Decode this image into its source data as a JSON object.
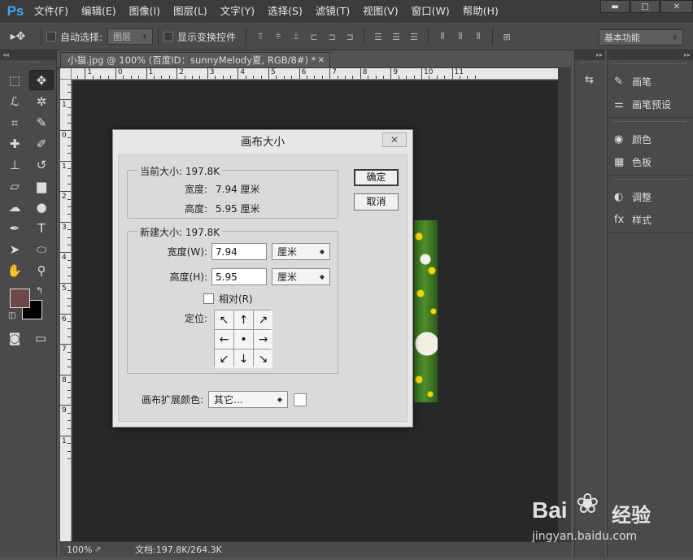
{
  "app": {
    "logo": "Ps"
  },
  "menu": [
    "文件(F)",
    "编辑(E)",
    "图像(I)",
    "图层(L)",
    "文字(Y)",
    "选择(S)",
    "滤镜(T)",
    "视图(V)",
    "窗口(W)",
    "帮助(H)"
  ],
  "window_controls": {
    "minimize": "▬",
    "maximize": "□",
    "close": "✕"
  },
  "options_bar": {
    "tool_glyph": "▸✥",
    "auto_select_label": "自动选择:",
    "auto_select_value": "图层",
    "show_transform_label": "显示变换控件",
    "workspace": "基本功能"
  },
  "toolbar": {
    "collapse": "◂◂",
    "tools": [
      {
        "name": "marquee-tool-icon",
        "glyph": "⬚"
      },
      {
        "name": "move-tool-icon",
        "glyph": "✥"
      },
      {
        "name": "lasso-tool-icon",
        "glyph": "ℒ"
      },
      {
        "name": "magic-wand-icon",
        "glyph": "✲"
      },
      {
        "name": "crop-tool-icon",
        "glyph": "⌗"
      },
      {
        "name": "eyedropper-icon",
        "glyph": "✎"
      },
      {
        "name": "healing-brush-icon",
        "glyph": "✚"
      },
      {
        "name": "brush-tool-icon",
        "glyph": "✐"
      },
      {
        "name": "clone-stamp-icon",
        "glyph": "⊥"
      },
      {
        "name": "history-brush-icon",
        "glyph": "↺"
      },
      {
        "name": "eraser-tool-icon",
        "glyph": "▱"
      },
      {
        "name": "gradient-tool-icon",
        "glyph": "▆"
      },
      {
        "name": "blur-tool-icon",
        "glyph": "☁"
      },
      {
        "name": "dodge-tool-icon",
        "glyph": "●"
      },
      {
        "name": "pen-tool-icon",
        "glyph": "✒"
      },
      {
        "name": "type-tool-icon",
        "glyph": "T"
      },
      {
        "name": "path-select-icon",
        "glyph": "➤"
      },
      {
        "name": "ellipse-tool-icon",
        "glyph": "⬭"
      },
      {
        "name": "hand-tool-icon",
        "glyph": "✋"
      },
      {
        "name": "zoom-tool-icon",
        "glyph": "⚲"
      }
    ],
    "swap_glyph": "↰",
    "default_glyph": "◫",
    "quickmask_glyph": "◙",
    "screenmode_glyph": "▭"
  },
  "document": {
    "tab_title": "小猫.jpg @ 100% (百度ID：sunnyMelody夏, RGB/8#) *",
    "tab_close": "✕",
    "ruler_top_labels": [
      "4",
      "3",
      "2",
      "1",
      "0",
      "1",
      "2",
      "3",
      "4",
      "5",
      "6",
      "7",
      "8",
      "9",
      "10",
      "11"
    ],
    "ruler_left_labels": [
      "2",
      "1",
      "0",
      "1",
      "2",
      "3",
      "4",
      "5",
      "6",
      "7",
      "8",
      "9",
      "1"
    ],
    "zoom": "100%",
    "status_icon": "⇗",
    "doc_info": "文档:197.8K/264.3K"
  },
  "panels": {
    "collapse": "▸▸",
    "history_icon": "⇆",
    "groups": [
      [
        {
          "icon": "✎",
          "label": "画笔",
          "name": "brush"
        },
        {
          "icon": "⚌",
          "label": "画笔预设",
          "name": "brush-presets"
        }
      ],
      [
        {
          "icon": "◉",
          "label": "颜色",
          "name": "color"
        },
        {
          "icon": "▦",
          "label": "色板",
          "name": "swatches"
        }
      ],
      [
        {
          "icon": "◐",
          "label": "调整",
          "name": "adjustments"
        },
        {
          "icon": "fx",
          "label": "样式",
          "name": "styles"
        }
      ]
    ]
  },
  "dialog": {
    "title": "画布大小",
    "close": "✕",
    "current_size_label": "当前大小: 197.8K",
    "current_width_label": "宽度:",
    "current_width_value": "7.94 厘米",
    "current_height_label": "高度:",
    "current_height_value": "5.95 厘米",
    "new_size_label": "新建大小: 197.8K",
    "width_label": "宽度(W):",
    "width_value": "7.94",
    "width_unit": "厘米",
    "height_label": "高度(H):",
    "height_value": "5.95",
    "height_unit": "厘米",
    "relative_label": "相对(R)",
    "anchor_label": "定位:",
    "anchor_arrows": [
      "↖",
      "↑",
      "↗",
      "←",
      "•",
      "→",
      "↙",
      "↓",
      "↘"
    ],
    "ext_color_label": "画布扩展颜色:",
    "ext_color_value": "其它...",
    "ok_label": "确定",
    "cancel_label": "取消",
    "select_arrow": "◆"
  },
  "watermark": {
    "logo": "Bai",
    "paw": "❀",
    "cn": "经验",
    "url": "jingyan.baidu.com"
  }
}
